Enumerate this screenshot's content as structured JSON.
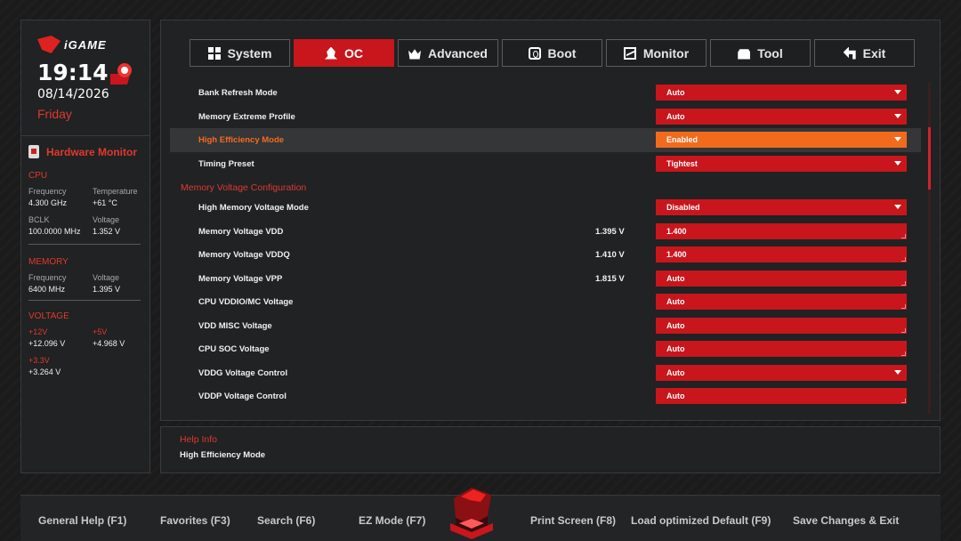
{
  "brand": {
    "logo_text": "iGAME"
  },
  "clock": {
    "time": "19:14",
    "date": "08/14/2026",
    "day": "Friday"
  },
  "hardware_monitor": {
    "title": "Hardware Monitor",
    "cpu": {
      "label": "CPU",
      "frequency_label": "Frequency",
      "frequency": "4.300 GHz",
      "temperature_label": "Temperature",
      "temperature": "+61 °C",
      "bclk_label": "BCLK",
      "bclk": "100.0000 MHz",
      "voltage_label": "Voltage",
      "voltage": "1.352 V"
    },
    "memory": {
      "label": "MEMORY",
      "frequency_label": "Frequency",
      "frequency": "6400 MHz",
      "voltage_label": "Voltage",
      "voltage": "1.395 V"
    },
    "voltage": {
      "label": "VOLTAGE",
      "v12_label": "+12V",
      "v12": "+12.096 V",
      "v5_label": "+5V",
      "v5": "+4.968 V",
      "v33_label": "+3.3V",
      "v33": "+3.264 V"
    }
  },
  "tabs": [
    {
      "label": "System",
      "icon": "grid-icon"
    },
    {
      "label": "OC",
      "icon": "rocket-icon",
      "active": true
    },
    {
      "label": "Advanced",
      "icon": "crown-icon"
    },
    {
      "label": "Boot",
      "icon": "power-icon"
    },
    {
      "label": "Monitor",
      "icon": "monitor-icon"
    },
    {
      "label": "Tool",
      "icon": "toolbox-icon"
    },
    {
      "label": "Exit",
      "icon": "exit-arrow-icon"
    }
  ],
  "settings": [
    {
      "name": "Bank Refresh Mode",
      "value": "Auto",
      "dropdown": true
    },
    {
      "name": "Memory Extreme Profile",
      "value": "Auto",
      "dropdown": true
    },
    {
      "name": "High Efficiency Mode",
      "value": "Enabled",
      "dropdown": true,
      "highlighted": true
    },
    {
      "name": "Timing Preset",
      "value": "Tightest",
      "dropdown": true
    },
    {
      "section": "Memory Voltage Configuration"
    },
    {
      "name": "High Memory Voltage Mode",
      "value": "Disabled",
      "dropdown": true
    },
    {
      "name": "Memory Voltage VDD",
      "current": "1.395 V",
      "value": "1.400"
    },
    {
      "name": "Memory Voltage VDDQ",
      "current": "1.410 V",
      "value": "1.400"
    },
    {
      "name": "Memory Voltage VPP",
      "current": "1.815 V",
      "value": "Auto"
    },
    {
      "name": "CPU VDDIO/MC Voltage",
      "value": "Auto"
    },
    {
      "name": "VDD MISC Voltage",
      "value": "Auto"
    },
    {
      "name": "CPU SOC Voltage",
      "value": "Auto"
    },
    {
      "name": "VDDG Voltage Control",
      "value": "Auto",
      "dropdown": true
    },
    {
      "name": "VDDP Voltage Control",
      "value": "Auto"
    }
  ],
  "help": {
    "title": "Help Info",
    "text": "High Efficiency Mode"
  },
  "bottom_bar": {
    "general_help": "General Help (F1)",
    "favorites": "Favorites (F3)",
    "search": "Search (F6)",
    "ez_mode": "EZ Mode (F7)",
    "print_screen": "Print Screen (F8)",
    "load_defaults": "Load optimized Default (F9)",
    "save_changes": "Save Changes & Exit"
  },
  "colors": {
    "accent_red": "#c8161c",
    "highlight_orange": "#f26b1d",
    "panel": "#202223"
  }
}
